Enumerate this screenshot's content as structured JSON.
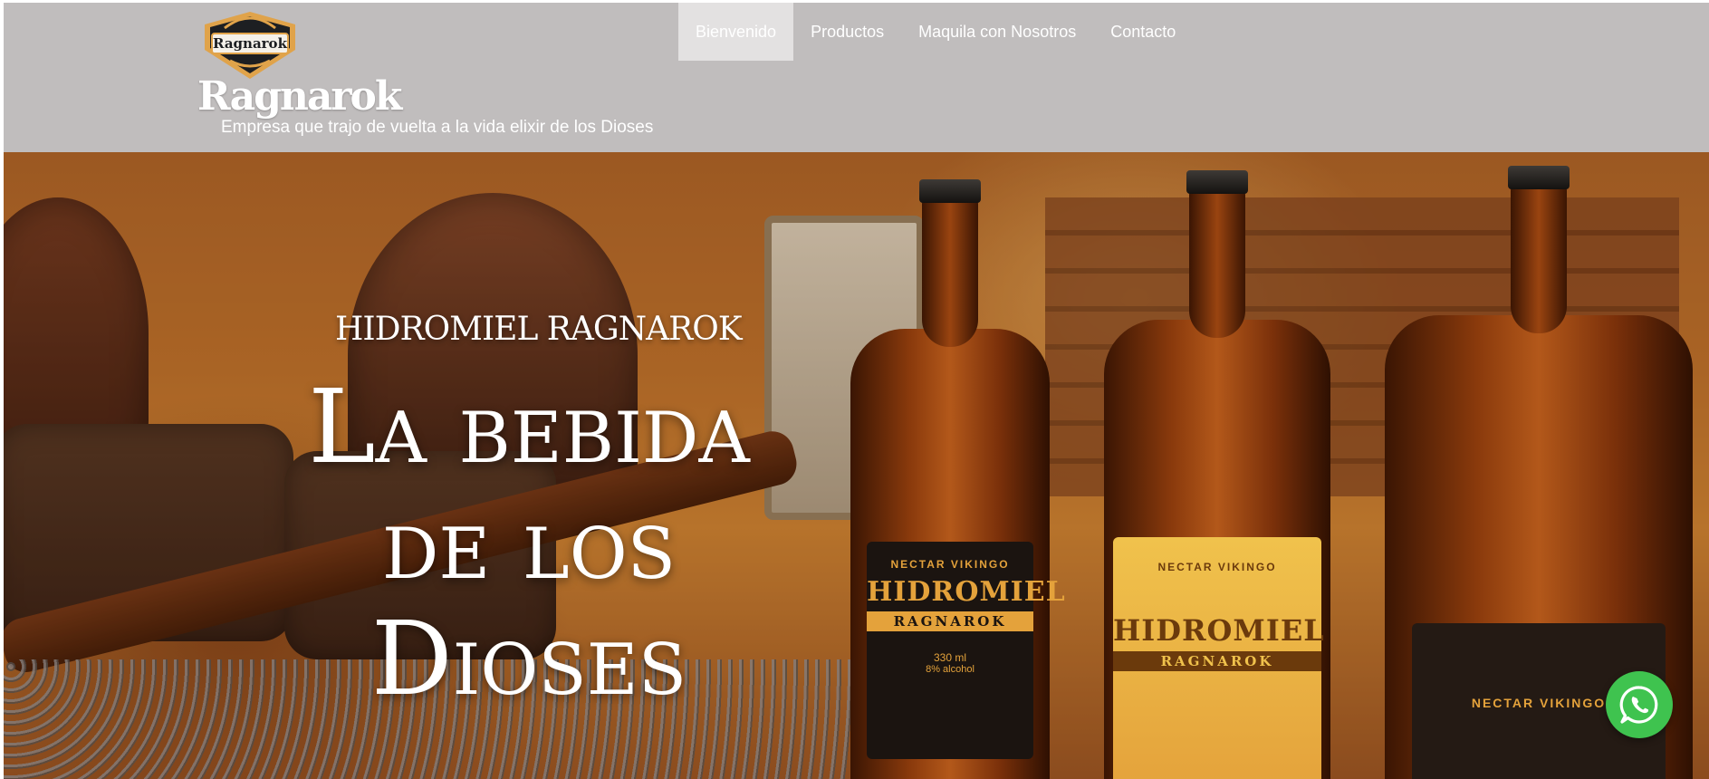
{
  "brand": {
    "logo_text": "Ragnarok",
    "name": "Ragnarok",
    "tagline": "Empresa que trajo de vuelta a la vida elixir de los Dioses"
  },
  "nav": {
    "items": [
      {
        "label": "Bienvenido",
        "active": true
      },
      {
        "label": "Productos",
        "active": false
      },
      {
        "label": "Maquila con Nosotros",
        "active": false
      },
      {
        "label": "Contacto",
        "active": false
      }
    ]
  },
  "hero": {
    "kicker": "HIDROMIEL RAGNAROK",
    "title_lines": [
      "La bebida",
      "de los",
      "Dioses"
    ],
    "bottles": [
      {
        "top_text": "NECTAR VIKINGO",
        "name": "HIDROMIEL",
        "sub": "RAGNAROK",
        "volume": "330 ml",
        "alcohol": "8% alcohol"
      },
      {
        "top_text": "NECTAR VIKINGO",
        "name": "HIDROMIEL",
        "sub": "RAGNAROK"
      },
      {
        "top_text": "NECTAR VIKINGO"
      }
    ]
  },
  "widgets": {
    "chat_icon": "whatsapp-icon"
  },
  "colors": {
    "header_bg": "#c0bdbd",
    "nav_active_bg": "#e3e1e1",
    "whatsapp_green": "#3fc34f",
    "text": "#ffffff"
  }
}
